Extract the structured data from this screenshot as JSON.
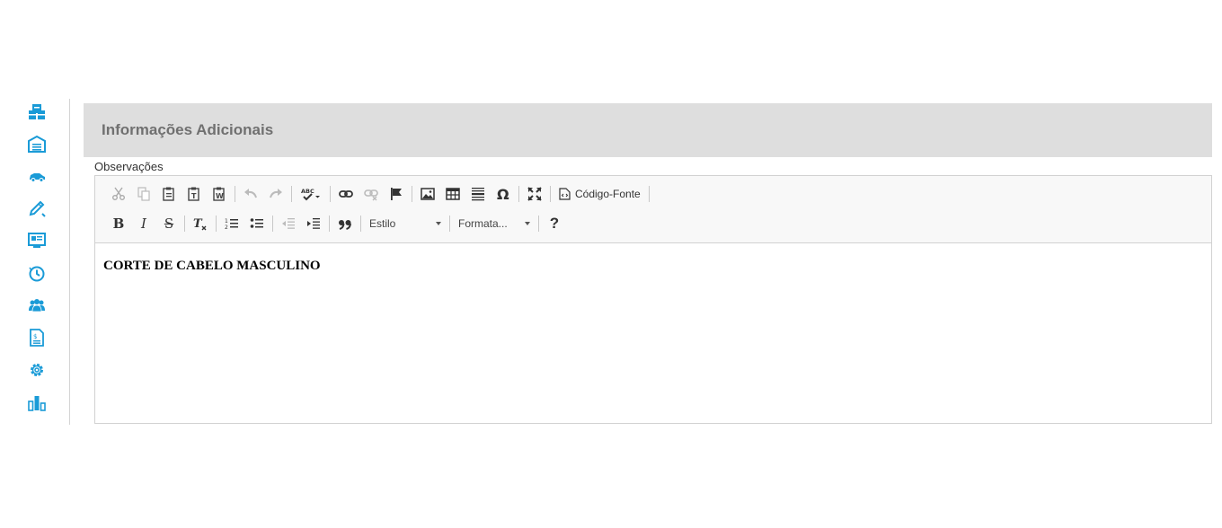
{
  "sidebar": {
    "icons": [
      "buildings-icon",
      "garage-icon",
      "car-icon",
      "pencil-icon",
      "monitor-id-card-icon",
      "history-icon",
      "users-icon",
      "invoice-icon",
      "gear-icon",
      "bar-chart-icon"
    ],
    "accent_color": "#1a9bd7"
  },
  "panel": {
    "title": "Informações Adicionais"
  },
  "editor": {
    "label": "Observações",
    "toolbar": {
      "source_label": "Código-Fonte",
      "style_combo": "Estilo",
      "format_combo": "Formata...",
      "bold_label": "B",
      "italic_label": "I",
      "strike_label": "S",
      "help_label": "?"
    },
    "content": "CORTE DE CABELO MASCULINO"
  }
}
